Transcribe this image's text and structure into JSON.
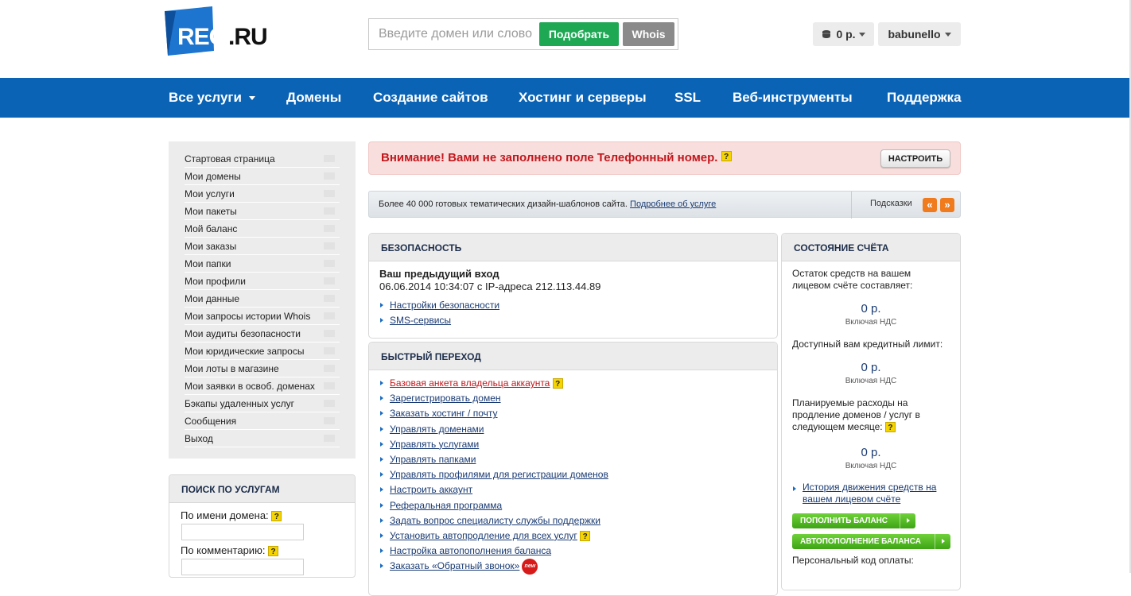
{
  "header": {
    "logo_reg": "REG",
    "logo_ru": ".RU",
    "search_placeholder": "Введите домен или слово",
    "pick_button": "Подобрать",
    "whois_button": "Whois",
    "balance": "0 р.",
    "username": "babunello"
  },
  "nav": [
    {
      "label": "Все услуги"
    },
    {
      "label": "Домены"
    },
    {
      "label": "Создание сайтов"
    },
    {
      "label": "Хостинг и серверы"
    },
    {
      "label": "SSL"
    },
    {
      "label": "Веб-инструменты"
    },
    {
      "label": "Поддержка"
    }
  ],
  "sidebar": {
    "items": [
      "Стартовая страница",
      "Мои домены",
      "Мои услуги",
      "Мои пакеты",
      "Мой баланс",
      "Мои заказы",
      "Мои папки",
      "Мои профили",
      "Мои данные",
      "Мои запросы истории Whois",
      "Мои аудиты безопасности",
      "Мои юридические запросы",
      "Мои лоты в магазине",
      "Мои заявки в освоб. доменах",
      "Бэкапы удаленных услуг",
      "Сообщения",
      "Выход"
    ]
  },
  "service_search": {
    "title": "ПОИСК ПО УСЛУГАМ",
    "by_domain": "По имени домена:",
    "by_comment": "По комментарию:"
  },
  "alert": {
    "text": "Внимание! Вами не заполнено поле Телефонный номер.",
    "button": "НАСТРОИТЬ"
  },
  "tip": {
    "text": "Более 40 000 готовых тематических дизайн-шаблонов сайта.",
    "link": "Подробнее об услуге",
    "hints_label": "Подсказки",
    "prev": "«",
    "next": "»"
  },
  "security": {
    "title": "БЕЗОПАСНОСТЬ",
    "last_login_title": "Ваш предыдущий вход",
    "last_login_info": "06.06.2014 10:34:07 с IP-адреса 212.113.44.89",
    "links": [
      "Настройки безопасности",
      "SMS-сервисы"
    ]
  },
  "quick": {
    "title": "БЫСТРЫЙ ПЕРЕХОД",
    "links": [
      "Базовая анкета владельца аккаунта",
      "Зарегистрировать домен",
      "Заказать хостинг / почту",
      "Управлять доменами",
      "Управлять услугами",
      "Управлять папками",
      "Управлять профилями для регистрации доменов",
      "Настроить аккаунт",
      "Реферальная программа",
      "Задать вопрос специалисту службы поддержки",
      "Установить автопродление для всех услуг",
      "Настройка автопополнения баланса",
      "Заказать «Обратный звонок»"
    ],
    "new_badge": "new"
  },
  "account": {
    "title": "СОСТОЯНИЕ СЧЁТА",
    "remaining_label": "Остаток средств на вашем лицевом счёте составляет:",
    "remaining_amount": "0 р.",
    "credit_label": "Доступный вам кредитный лимит:",
    "credit_amount": "0 р.",
    "planned_label": "Планируемые расходы на продление доменов / услуг в следующем месяце:",
    "planned_amount": "0 р.",
    "vat": "Включая НДС",
    "history_link": "История движения средств на вашем лицевом счёте",
    "topup_button": "ПОПОЛНИТЬ БАЛАНС",
    "autotopup_button": "АВТОПОПОЛНЕНИЕ БАЛАНСА",
    "payment_code_label": "Персональный код оплаты:"
  },
  "help_mark": "?",
  "colors": {
    "brand_blue": "#0a63b5",
    "green": "#1ea854",
    "alert_red": "#c2171d",
    "orange": "#f07b1e"
  }
}
